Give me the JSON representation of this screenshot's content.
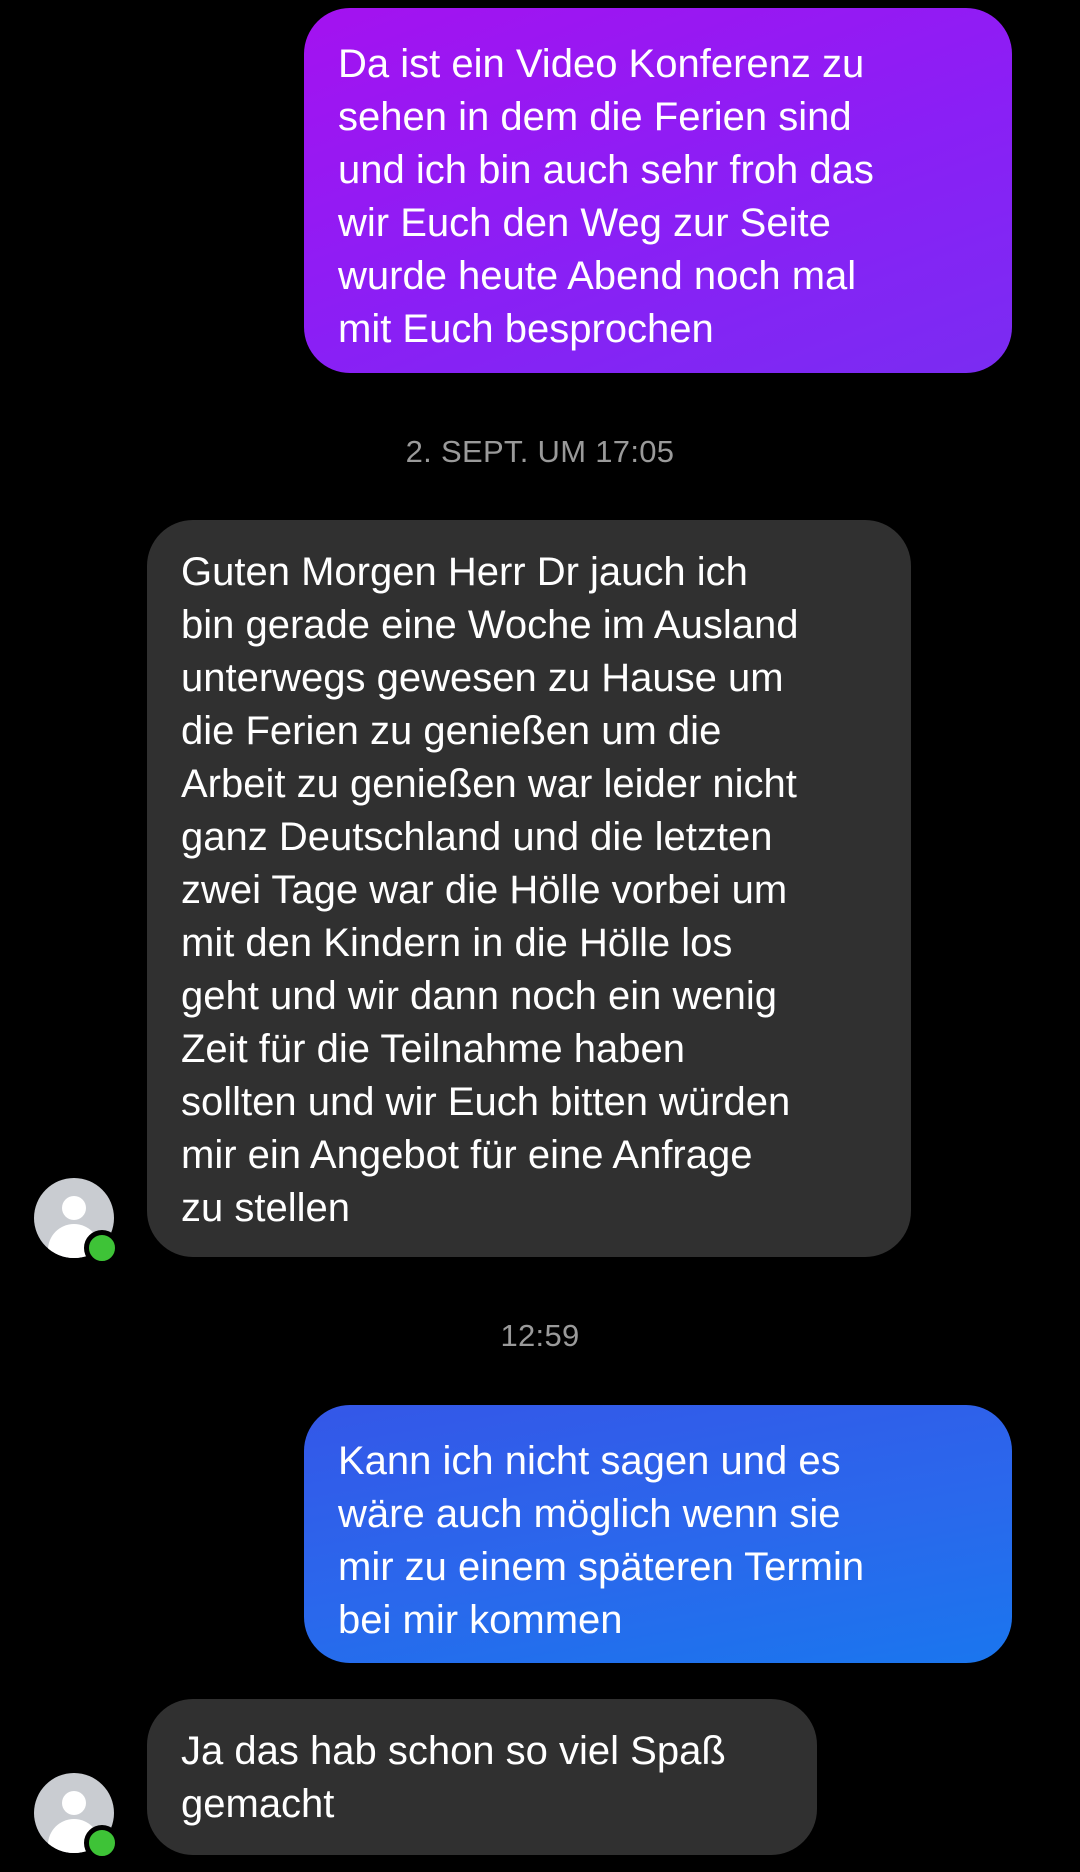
{
  "conversation": {
    "messages": [
      {
        "direction": "sent",
        "text": "Da ist ein Video Konferenz zu\nsehen in dem die Ferien sind\nund ich bin auch sehr froh das\nwir Euch den Weg zur Seite\nwurde heute Abend noch mal\nmit Euch besprochen"
      },
      {
        "direction": "received",
        "text": "Guten Morgen Herr Dr jauch ich\nbin gerade eine Woche im Ausland\nunterwegs gewesen zu Hause um\ndie Ferien zu genießen um die\nArbeit zu genießen war leider nicht\nganz Deutschland und die letzten\nzwei Tage war die Hölle vorbei um\nmit den Kindern in die Hölle los\ngeht und wir dann noch ein wenig\nZeit für die Teilnahme haben\nsollten und wir Euch bitten würden\nmir ein Angebot für eine Anfrage\nzu stellen"
      },
      {
        "direction": "sent",
        "text": "Kann ich nicht sagen und es\nwäre auch möglich wenn sie\nmir zu einem späteren Termin\nbei mir kommen"
      },
      {
        "direction": "received",
        "text": "Ja das hab schon so viel Spaß\ngemacht"
      }
    ],
    "timestamps": [
      "2. SEPT. UM 17:05",
      "12:59"
    ]
  },
  "avatars": [
    {
      "icon": "default-user-icon",
      "status": "online"
    },
    {
      "icon": "default-user-icon",
      "status": "online"
    }
  ],
  "colors": {
    "background": "#000000",
    "sent_gradient_purple": [
      "#a412f0",
      "#7a2cf2"
    ],
    "sent_gradient_blue": [
      "#3457e8",
      "#1a76ee"
    ],
    "received_bubble": "#303030",
    "timestamp_text": "#9a9a9a",
    "online_indicator": "#3ec337"
  }
}
